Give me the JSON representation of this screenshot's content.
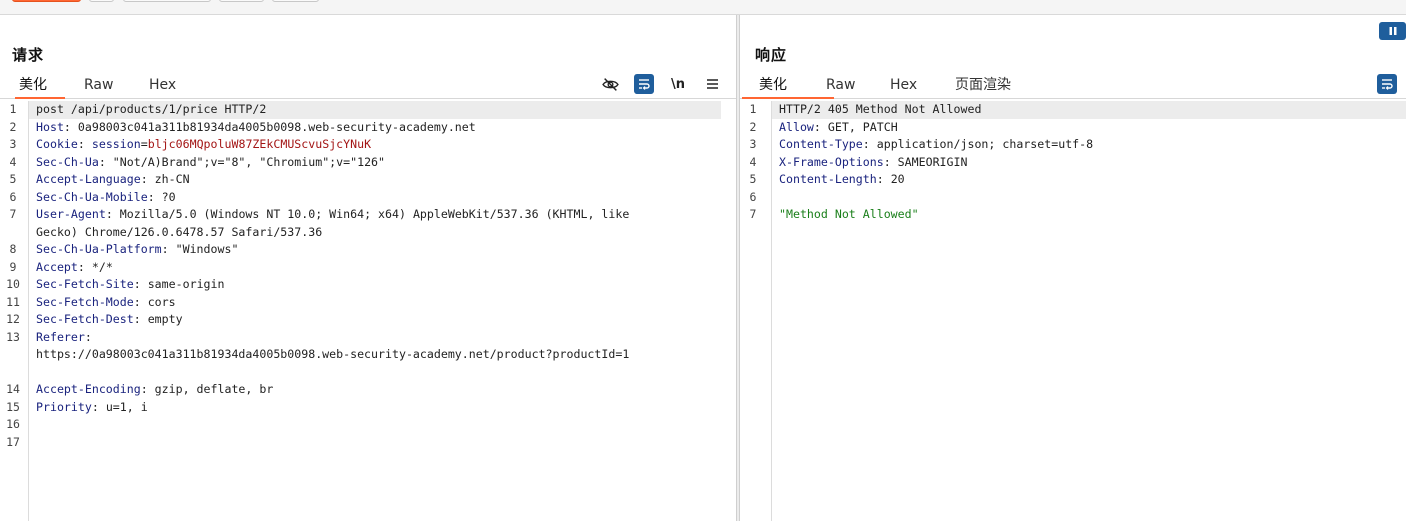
{
  "request": {
    "title": "请求",
    "tabs": [
      "美化",
      "Raw",
      "Hex"
    ],
    "active_tab": 0,
    "tools": {
      "hide_icon": "eye-slash-icon",
      "wrap_icon": "word-wrap-icon",
      "newline_label": "\\n",
      "menu_icon": "hamburger-menu-icon"
    },
    "lines": [
      {
        "n": "1",
        "plain": "post /api/products/1/price HTTP/2"
      },
      {
        "n": "2",
        "key": "Host",
        "value": "0a98003c041a311b81934da4005b0098.web-security-academy.net"
      },
      {
        "n": "3",
        "key": "Cookie",
        "cookie_name": "session",
        "cookie_value": "bljc06MQpoluW87ZEkCMUScvuSjcYNuK"
      },
      {
        "n": "4",
        "key": "Sec-Ch-Ua",
        "value": "\"Not/A)Brand\";v=\"8\", \"Chromium\";v=\"126\""
      },
      {
        "n": "5",
        "key": "Accept-Language",
        "value": "zh-CN"
      },
      {
        "n": "6",
        "key": "Sec-Ch-Ua-Mobile",
        "value": "?0"
      },
      {
        "n": "7",
        "key": "User-Agent",
        "value": "Mozilla/5.0 (Windows NT 10.0; Win64; x64) AppleWebKit/537.36 (KHTML, like"
      },
      {
        "n": "",
        "cont": "Gecko) Chrome/126.0.6478.57 Safari/537.36"
      },
      {
        "n": "8",
        "key": "Sec-Ch-Ua-Platform",
        "value": "\"Windows\""
      },
      {
        "n": "9",
        "key": "Accept",
        "value": "*/*"
      },
      {
        "n": "10",
        "key": "Sec-Fetch-Site",
        "value": "same-origin"
      },
      {
        "n": "11",
        "key": "Sec-Fetch-Mode",
        "value": "cors"
      },
      {
        "n": "12",
        "key": "Sec-Fetch-Dest",
        "value": "empty"
      },
      {
        "n": "13",
        "key": "Referer",
        "value": ""
      },
      {
        "n": "",
        "cont": "https://0a98003c041a311b81934da4005b0098.web-security-academy.net/product?productId=1"
      },
      {
        "n": "",
        "cont": ""
      },
      {
        "n": "14",
        "key": "Accept-Encoding",
        "value": "gzip, deflate, br"
      },
      {
        "n": "15",
        "key": "Priority",
        "value": "u=1, i"
      },
      {
        "n": "16",
        "plain": ""
      },
      {
        "n": "17",
        "plain": ""
      }
    ]
  },
  "response": {
    "title": "响应",
    "tabs": [
      "美化",
      "Raw",
      "Hex",
      "页面渲染"
    ],
    "active_tab": 0,
    "tools": {
      "wrap_icon": "word-wrap-icon",
      "pause_icon": "pause-icon"
    },
    "lines": [
      {
        "n": "1",
        "plain": "HTTP/2 405 Method Not Allowed"
      },
      {
        "n": "2",
        "key": "Allow",
        "value": "GET, PATCH"
      },
      {
        "n": "3",
        "key": "Content-Type",
        "value": "application/json; charset=utf-8"
      },
      {
        "n": "4",
        "key": "X-Frame-Options",
        "value": "SAMEORIGIN"
      },
      {
        "n": "5",
        "key": "Content-Length",
        "value": "20"
      },
      {
        "n": "6",
        "plain": ""
      },
      {
        "n": "7",
        "body": "\"Method Not Allowed\""
      }
    ]
  },
  "colors": {
    "accent": "#ff6633",
    "header_key": "#1a237e",
    "cookie_value": "#a31515",
    "body_string": "#1a7f1a",
    "tool_blue": "#1f5e9c"
  }
}
